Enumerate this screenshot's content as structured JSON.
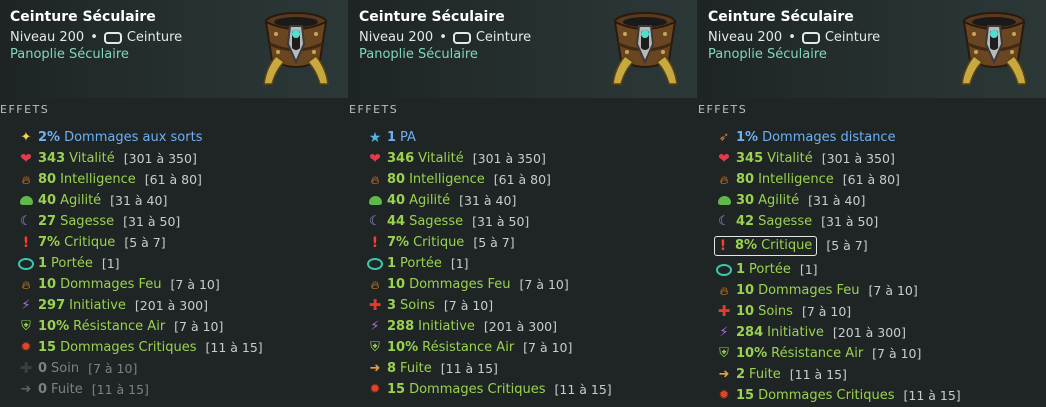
{
  "panels": [
    {
      "title": "Ceinture Séculaire",
      "level": "Niveau 200",
      "type": "Ceinture",
      "set": "Panoplie Séculaire",
      "effects_label": "EFFETS",
      "effects": [
        {
          "icon": "star-icon",
          "value": "2%",
          "name": "Dommages aux sorts",
          "range": "",
          "style": "exo"
        },
        {
          "icon": "heart-icon",
          "value": "343",
          "name": "Vitalité",
          "range": "[301 à 350]",
          "style": "normal"
        },
        {
          "icon": "flame-icon",
          "value": "80",
          "name": "Intelligence",
          "range": "[61 à 80]",
          "style": "normal"
        },
        {
          "icon": "agility-icon",
          "value": "40",
          "name": "Agilité",
          "range": "[31 à 40]",
          "style": "normal"
        },
        {
          "icon": "moon-icon",
          "value": "27",
          "name": "Sagesse",
          "range": "[31 à 50]",
          "style": "normal"
        },
        {
          "icon": "exclamation-icon",
          "value": "7%",
          "name": "Critique",
          "range": "[5 à 7]",
          "style": "normal"
        },
        {
          "icon": "eye-icon",
          "value": "1",
          "name": "Portée",
          "range": "[1]",
          "style": "normal"
        },
        {
          "icon": "flame-icon",
          "value": "10",
          "name": "Dommages Feu",
          "range": "[7 à 10]",
          "style": "normal"
        },
        {
          "icon": "initiative-icon",
          "value": "297",
          "name": "Initiative",
          "range": "[201 à 300]",
          "style": "normal"
        },
        {
          "icon": "shield-icon",
          "value": "10%",
          "name": "Résistance Air",
          "range": "[7 à 10]",
          "style": "normal"
        },
        {
          "icon": "crit-damage-icon",
          "value": "15",
          "name": "Dommages Critiques",
          "range": "[11 à 15]",
          "style": "normal"
        },
        {
          "icon": "cross-icon",
          "value": "0",
          "name": "Soin",
          "range": "[7 à 10]",
          "style": "inactive"
        },
        {
          "icon": "flee-icon",
          "value": "0",
          "name": "Fuite",
          "range": "[11 à 15]",
          "style": "inactive"
        }
      ]
    },
    {
      "title": "Ceinture Séculaire",
      "level": "Niveau 200",
      "type": "Ceinture",
      "set": "Panoplie Séculaire",
      "effects_label": "EFFETS",
      "effects": [
        {
          "icon": "pa-star-icon",
          "value": "1",
          "name": "PA",
          "range": "",
          "style": "exo"
        },
        {
          "icon": "heart-icon",
          "value": "346",
          "name": "Vitalité",
          "range": "[301 à 350]",
          "style": "normal"
        },
        {
          "icon": "flame-icon",
          "value": "80",
          "name": "Intelligence",
          "range": "[61 à 80]",
          "style": "normal"
        },
        {
          "icon": "agility-icon",
          "value": "40",
          "name": "Agilité",
          "range": "[31 à 40]",
          "style": "normal"
        },
        {
          "icon": "moon-icon",
          "value": "44",
          "name": "Sagesse",
          "range": "[31 à 50]",
          "style": "normal"
        },
        {
          "icon": "exclamation-icon",
          "value": "7%",
          "name": "Critique",
          "range": "[5 à 7]",
          "style": "normal"
        },
        {
          "icon": "eye-icon",
          "value": "1",
          "name": "Portée",
          "range": "[1]",
          "style": "normal"
        },
        {
          "icon": "flame-icon",
          "value": "10",
          "name": "Dommages Feu",
          "range": "[7 à 10]",
          "style": "normal"
        },
        {
          "icon": "cross-icon",
          "value": "3",
          "name": "Soins",
          "range": "[7 à 10]",
          "style": "normal"
        },
        {
          "icon": "initiative-icon",
          "value": "288",
          "name": "Initiative",
          "range": "[201 à 300]",
          "style": "normal"
        },
        {
          "icon": "shield-icon",
          "value": "10%",
          "name": "Résistance Air",
          "range": "[7 à 10]",
          "style": "normal"
        },
        {
          "icon": "flee-icon",
          "value": "8",
          "name": "Fuite",
          "range": "[11 à 15]",
          "style": "normal"
        },
        {
          "icon": "crit-damage-icon",
          "value": "15",
          "name": "Dommages Critiques",
          "range": "[11 à 15]",
          "style": "normal"
        }
      ]
    },
    {
      "title": "Ceinture Séculaire",
      "level": "Niveau 200",
      "type": "Ceinture",
      "set": "Panoplie Séculaire",
      "effects_label": "EFFETS",
      "effects": [
        {
          "icon": "bow-icon",
          "value": "1%",
          "name": "Dommages distance",
          "range": "",
          "style": "exo"
        },
        {
          "icon": "heart-icon",
          "value": "345",
          "name": "Vitalité",
          "range": "[301 à 350]",
          "style": "normal"
        },
        {
          "icon": "flame-icon",
          "value": "80",
          "name": "Intelligence",
          "range": "[61 à 80]",
          "style": "normal"
        },
        {
          "icon": "agility-icon",
          "value": "30",
          "name": "Agilité",
          "range": "[31 à 40]",
          "style": "normal"
        },
        {
          "icon": "moon-icon",
          "value": "42",
          "name": "Sagesse",
          "range": "[31 à 50]",
          "style": "normal"
        },
        {
          "icon": "exclamation-icon",
          "value": "8%",
          "name": "Critique",
          "range": "[5 à 7]",
          "style": "boxed"
        },
        {
          "icon": "eye-icon",
          "value": "1",
          "name": "Portée",
          "range": "[1]",
          "style": "normal"
        },
        {
          "icon": "flame-icon",
          "value": "10",
          "name": "Dommages Feu",
          "range": "[7 à 10]",
          "style": "normal"
        },
        {
          "icon": "cross-icon",
          "value": "10",
          "name": "Soins",
          "range": "[7 à 10]",
          "style": "normal"
        },
        {
          "icon": "initiative-icon",
          "value": "284",
          "name": "Initiative",
          "range": "[201 à 300]",
          "style": "normal"
        },
        {
          "icon": "shield-icon",
          "value": "10%",
          "name": "Résistance Air",
          "range": "[7 à 10]",
          "style": "normal"
        },
        {
          "icon": "flee-icon",
          "value": "2",
          "name": "Fuite",
          "range": "[11 à 15]",
          "style": "normal"
        },
        {
          "icon": "crit-damage-icon",
          "value": "15",
          "name": "Dommages Critiques",
          "range": "[11 à 15]",
          "style": "normal"
        }
      ]
    }
  ],
  "colors": {
    "stat_green": "#9ad250",
    "exo_blue": "#6fb0f4",
    "set_teal": "#7fd7bd",
    "inactive_grey": "#7c8282"
  }
}
